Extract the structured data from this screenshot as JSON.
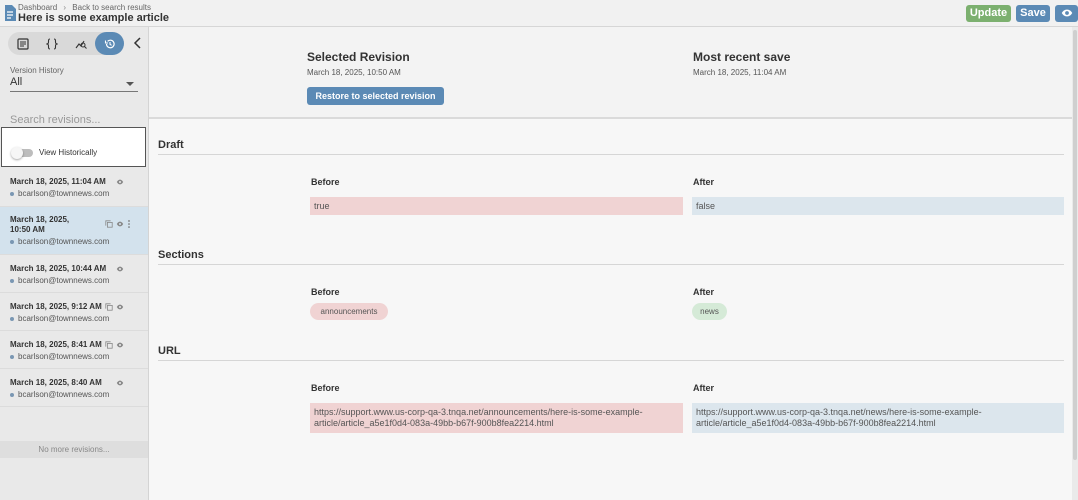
{
  "header": {
    "breadcrumb": [
      "Dashboard",
      "Back to search results"
    ],
    "breadcrumb_sep": "›",
    "title": "Here is some example article",
    "update_label": "Update",
    "save_label": "Save",
    "preview_icon": "eye-icon",
    "colors": {
      "update": "#7cb06f",
      "save": "#5b8ab5"
    }
  },
  "sidebar": {
    "tools": [
      {
        "icon": "document-icon",
        "active": false
      },
      {
        "icon": "code-braces-icon",
        "active": false
      },
      {
        "icon": "analytics-icon",
        "active": false
      },
      {
        "icon": "history-icon",
        "active": true
      }
    ],
    "version_history_label": "Version History",
    "version_history_value": "All",
    "search_placeholder": "Search revisions...",
    "toggle_label": "View Historically",
    "toggle_on": false,
    "revisions": [
      {
        "date": "March 18, 2025, 11:04 AM",
        "user": "bcarlson@townnews.com",
        "selected": false
      },
      {
        "date": "March 18, 2025, 10:50 AM",
        "user": "bcarlson@townnews.com",
        "selected": true
      },
      {
        "date": "March 18, 2025, 10:44 AM",
        "user": "bcarlson@townnews.com",
        "selected": false
      },
      {
        "date": "March 18, 2025, 9:12 AM",
        "user": "bcarlson@townnews.com",
        "selected": false
      },
      {
        "date": "March 18, 2025, 8:41 AM",
        "user": "bcarlson@townnews.com",
        "selected": false
      },
      {
        "date": "March 18, 2025, 8:40 AM",
        "user": "bcarlson@townnews.com",
        "selected": false
      }
    ],
    "rev0_date": "March 18, 2025, 11:04 AM",
    "rev1_date_a": "March 18, 2025,",
    "rev1_date_b": "10:50 AM",
    "rev2_date": "March 18, 2025, 10:44 AM",
    "rev3_date": "March 18, 2025, 9:12 AM",
    "rev4_date": "March 18, 2025, 8:41 AM",
    "rev5_date": "March 18, 2025, 8:40 AM",
    "user": "bcarlson@townnews.com",
    "no_more": "No more revisions..."
  },
  "main": {
    "selected_title": "Selected Revision",
    "selected_date": "March 18, 2025, 10:50 AM",
    "recent_title": "Most recent save",
    "recent_date": "March 18, 2025, 11:04 AM",
    "restore_label": "Restore to selected revision",
    "before_label": "Before",
    "after_label": "After",
    "sections": {
      "draft": {
        "title": "Draft",
        "before": "true",
        "after": "false"
      },
      "sections": {
        "title": "Sections",
        "before": "announcements",
        "after": "news"
      },
      "url": {
        "title": "URL",
        "before_a": "https://support.www.us-corp-qa-3.tnqa.net/announcements/here-is-some-example-",
        "before_b": "article/article_a5e1f0d4-083a-49bb-b67f-900b8fea2214.html",
        "after_a": "https://support.www.us-corp-qa-3.tnqa.net/news/here-is-some-example-",
        "after_b": "article/article_a5e1f0d4-083a-49bb-b67f-900b8fea2214.html"
      }
    },
    "colors": {
      "before": "#f0d3d3",
      "after": "#dce6ed",
      "chip_after": "#d5ead7"
    }
  }
}
